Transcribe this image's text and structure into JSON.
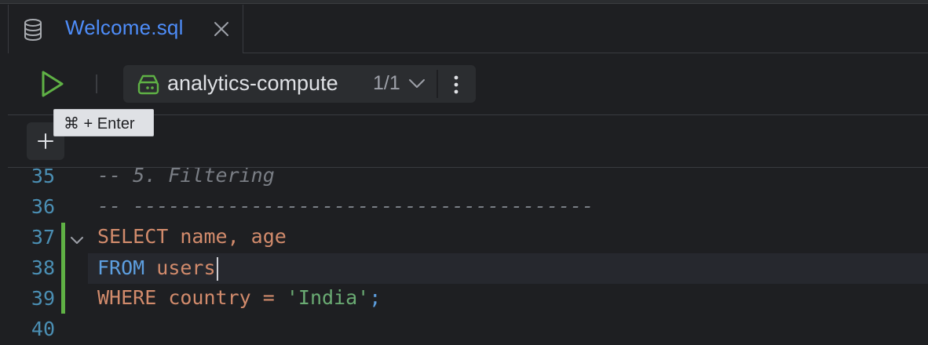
{
  "tab": {
    "title": "Welcome.sql",
    "icon": "database-icon"
  },
  "toolbar": {
    "session_name": "analytics-compute",
    "session_count": "1/1",
    "run_tooltip": "⌘ + Enter"
  },
  "editor": {
    "lines": [
      {
        "number": "35",
        "text": "-- 5. Filtering"
      },
      {
        "number": "36",
        "text": "-- ---------------------------------------"
      },
      {
        "number": "37",
        "kw": "SELECT",
        "rest": " name, age"
      },
      {
        "number": "38",
        "kw": "FROM",
        "rest": " users"
      },
      {
        "number": "39",
        "kw": "WHERE",
        "rest": " country = ",
        "str": "'India'",
        "end": ";"
      },
      {
        "number": "40",
        "text": ""
      }
    ]
  },
  "colors": {
    "accent_blue": "#4e8dfa",
    "run_green": "#5fb145",
    "keyword": "#d28b6c",
    "string": "#6aab73",
    "comment": "#7a7e85"
  }
}
